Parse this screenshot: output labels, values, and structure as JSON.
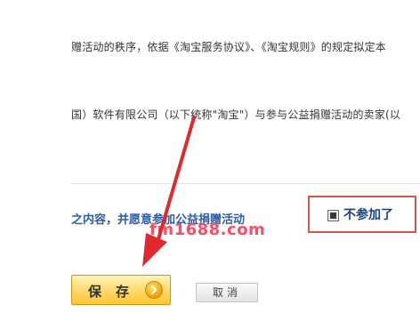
{
  "agreement": {
    "line1": "赠活动的秩序，依据《淘宝服务协议》、《淘宝规则》的规定拟定本",
    "line2": "国）软件有限公司（以下统称\"淘宝\"）与参与公益捐赠活动的卖家(以",
    "agree_text": "之内容，并愿意参加公益捐赠活动"
  },
  "opt_out": {
    "label": "不参加了",
    "selected": true
  },
  "watermark": "fm1688.com",
  "actions": {
    "save_label": "保存",
    "cancel_label": "取消"
  },
  "colors": {
    "annotation_red": "#e0282f",
    "link_blue": "#2b5ca8",
    "save_yellow": "#ffd86a"
  }
}
